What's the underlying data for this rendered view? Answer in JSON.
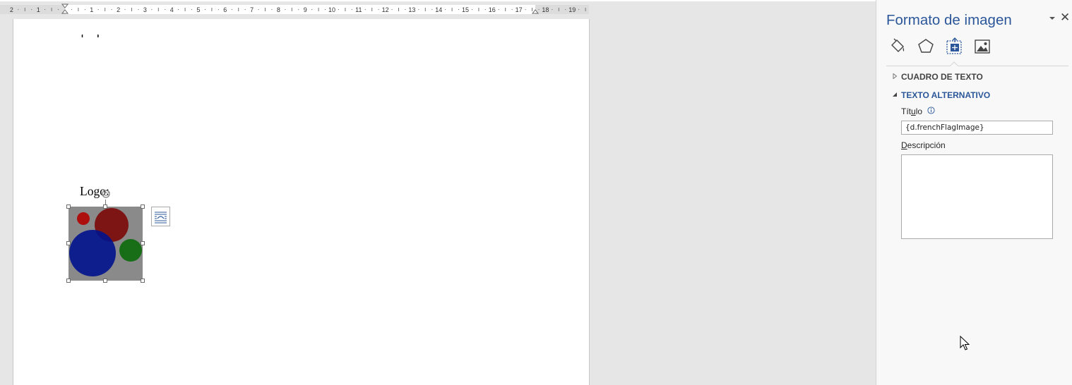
{
  "ruler": {
    "labels": [
      "2",
      "1",
      "1",
      "2",
      "3",
      "4",
      "5",
      "6",
      "7",
      "8",
      "9",
      "10",
      "11",
      "12",
      "13",
      "14",
      "15",
      "16",
      "17",
      "18",
      "19"
    ]
  },
  "document": {
    "logo_label": "Logo:",
    "image": {
      "background_color": "#8a8a8a",
      "circle_colors": [
        "#b00000",
        "#7a0000",
        "#00128c",
        "#0a6a0a"
      ]
    }
  },
  "pane": {
    "title": "Formato de imagen",
    "icons": {
      "options": "chevron-down-icon",
      "close": "close-icon",
      "tabs": [
        "fill-line-icon",
        "effects-pentagon-icon",
        "layout-properties-icon",
        "picture-icon"
      ]
    },
    "close_glyph": "✕",
    "sections": [
      {
        "label": "CUADRO DE TEXTO",
        "expanded": false
      },
      {
        "label": "TEXTO ALTERNATIVO",
        "expanded": true
      }
    ],
    "alt_text": {
      "title_label_pre": "Tít",
      "title_label_underlined": "u",
      "title_label_post": "lo",
      "title_value": "{d.frenchFlagImage}",
      "description_label_underlined": "D",
      "description_label_rest": "escripción",
      "description_value": ""
    },
    "colors": {
      "accent": "#2b579a",
      "header_text": "#444444"
    }
  }
}
